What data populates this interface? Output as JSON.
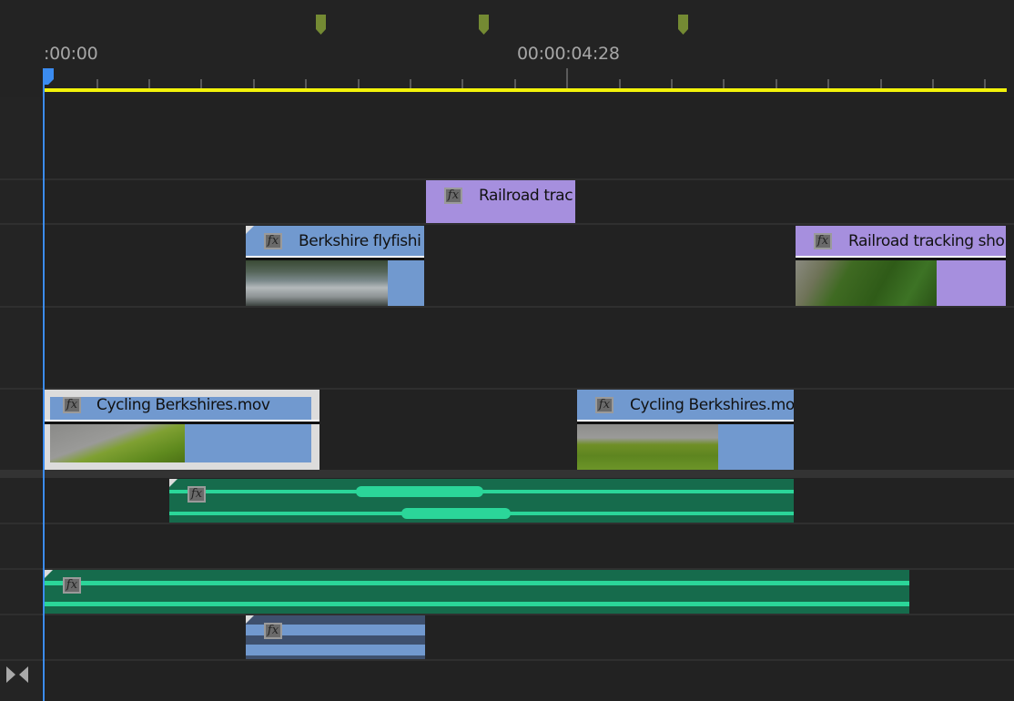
{
  "timeline": {
    "ruler": {
      "timecodes": [
        ":00:00",
        "00:00:04:28"
      ],
      "markers": [
        {
          "name": "marker-1"
        },
        {
          "name": "marker-2"
        },
        {
          "name": "marker-3"
        }
      ],
      "marker_color": "#748a33",
      "work_area_color": "#f2f20a",
      "playhead_color": "#3b8cf0"
    },
    "clips": {
      "railroad_short": {
        "label": "Railroad trac",
        "kind": "video",
        "color": "#a68fde"
      },
      "berkshire_flyfishing": {
        "label": "Berkshire flyfishi",
        "kind": "video",
        "color": "#7199cf"
      },
      "railroad_tracking": {
        "label": "Railroad tracking sho",
        "kind": "video",
        "color": "#a68fde"
      },
      "cycling_1": {
        "label": "Cycling Berkshires.mov",
        "kind": "video",
        "color": "#7199cf",
        "selected": true
      },
      "cycling_2": {
        "label": "Cycling Berkshires.mo",
        "kind": "video",
        "color": "#7199cf"
      },
      "audio_1": {
        "kind": "audio",
        "color": "#166b4c"
      },
      "audio_2": {
        "kind": "audio",
        "color": "#166b4c"
      },
      "audio_3": {
        "kind": "audio",
        "color": "#3e506e"
      }
    },
    "fx_label": "fx",
    "footer": {
      "zoom_icon": "zoom-to-fit-icon"
    }
  }
}
